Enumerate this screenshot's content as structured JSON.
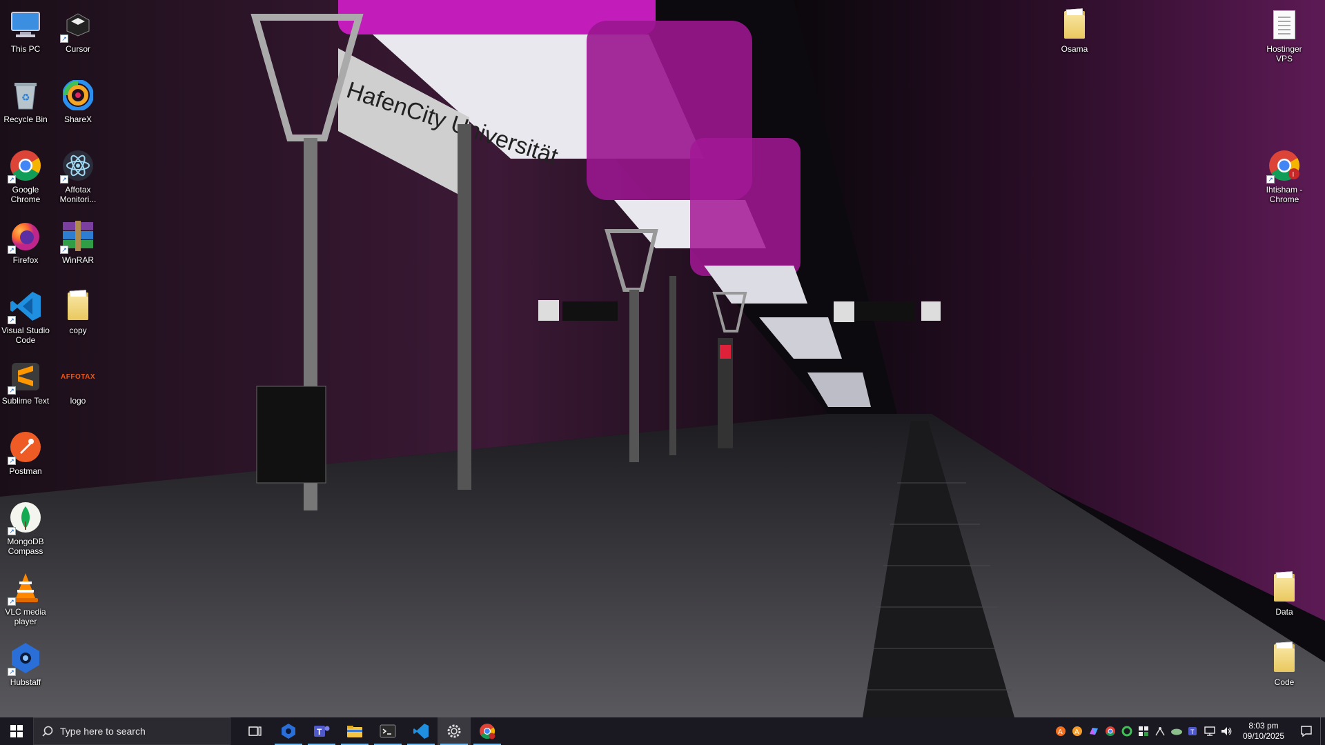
{
  "desktop": {
    "icons_left": [
      {
        "id": "this-pc",
        "label": "This PC"
      },
      {
        "id": "cursor",
        "label": "Cursor"
      },
      {
        "id": "recycle-bin",
        "label": "Recycle Bin"
      },
      {
        "id": "sharex",
        "label": "ShareX"
      },
      {
        "id": "google-chrome",
        "label": "Google Chrome"
      },
      {
        "id": "affotax-monitor",
        "label": "Affotax Monitori..."
      },
      {
        "id": "firefox",
        "label": "Firefox"
      },
      {
        "id": "winrar",
        "label": "WinRAR"
      },
      {
        "id": "vscode",
        "label": "Visual Studio Code"
      },
      {
        "id": "copy",
        "label": "copy"
      },
      {
        "id": "sublime",
        "label": "Sublime Text"
      },
      {
        "id": "logo",
        "label": "logo",
        "logo_text": "AFFOTAX"
      },
      {
        "id": "postman",
        "label": "Postman"
      },
      {
        "id": "mongodb",
        "label": "MongoDB Compass"
      },
      {
        "id": "vlc",
        "label": "VLC media player"
      },
      {
        "id": "hubstaff",
        "label": "Hubstaff"
      }
    ],
    "icons_right": [
      {
        "id": "osama",
        "label": "Osama"
      },
      {
        "id": "hostinger",
        "label": "Hostinger VPS"
      },
      {
        "id": "ihtisham-chrome",
        "label": "Ihtisham - Chrome"
      },
      {
        "id": "data",
        "label": "Data"
      },
      {
        "id": "code",
        "label": "Code"
      }
    ],
    "wallpaper_sign": "HafenCity Universität"
  },
  "taskbar": {
    "search_placeholder": "Type here to search",
    "pinned": [
      "task-view",
      "hubstaff",
      "teams",
      "file-explorer",
      "terminal",
      "vscode",
      "settings",
      "chrome"
    ],
    "tray_icons": [
      "avast-icon",
      "avast-2-icon",
      "copilot-icon",
      "chrome-tray-icon",
      "sharex-tray-icon",
      "security-icon",
      "network-sync-icon",
      "onedrive-icon",
      "teams-tray-icon",
      "network-icon",
      "volume-icon"
    ],
    "clock_time": "8:03 pm",
    "clock_date": "09/10/2025"
  },
  "colors": {
    "accent": "#76b9ed",
    "taskbar": "#1a1820",
    "neon_magenta": "#d21cc9"
  }
}
